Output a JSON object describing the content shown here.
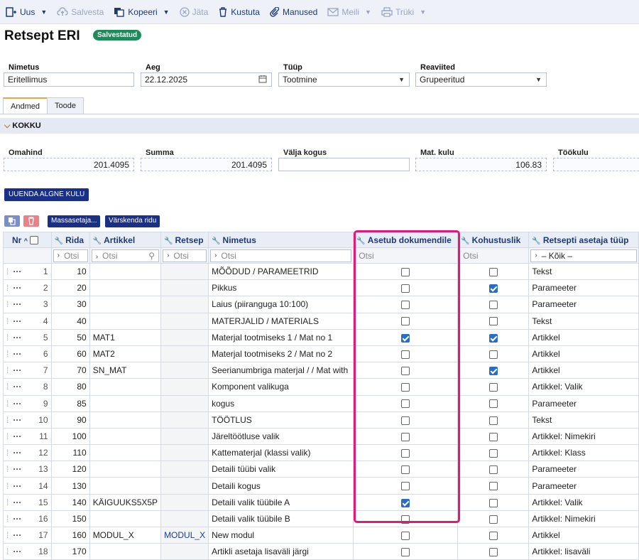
{
  "toolbar": {
    "new": "Uus",
    "save": "Salvesta",
    "copy": "Kopeeri",
    "skip": "Jäta",
    "delete": "Kustuta",
    "attachments": "Manused",
    "mail": "Meili",
    "print": "Trüki"
  },
  "header": {
    "title": "Retsept ERI",
    "status": "Salvestatud"
  },
  "form": {
    "name_label": "Nimetus",
    "name_value": "Eritellimus",
    "time_label": "Aeg",
    "time_value": "22.12.2025",
    "type_label": "Tüüp",
    "type_value": "Tootmine",
    "rows_label": "Reaviited",
    "rows_value": "Grupeeritud"
  },
  "tabs": [
    "Andmed",
    "Toode"
  ],
  "section": {
    "title": "KOKKU"
  },
  "totals": {
    "cost_label": "Omahind",
    "cost_value": "201.4095",
    "sum_label": "Summa",
    "sum_value": "201.4095",
    "output_label": "Välja kogus",
    "output_value": "",
    "mat_label": "Mat. kulu",
    "mat_value": "106.83",
    "work_label": "Töökulu"
  },
  "buttons": {
    "update": "UUENDA ALGNE KULU",
    "mass": "Massasetaja...",
    "refresh": "Värskenda ridu"
  },
  "columns": {
    "nr": "Nr",
    "rida": "Rida",
    "artikkel": "Artikkel",
    "retsep": "Retsep",
    "nimetus": "Nimetus",
    "asetub": "Asetub dokumendile",
    "kohustuslik": "Kohustuslik",
    "tyyp": "Retsepti asetaja tüüp"
  },
  "filters": {
    "search": "Otsi",
    "all": "– Kõik –"
  },
  "rows": [
    {
      "nr": "1",
      "rida": "10",
      "artikkel": "",
      "retsep": "",
      "nimetus": "MÕÕDUD / PARAMEETRID",
      "asetub": false,
      "kohustuslik": false,
      "tyyp": "Tekst"
    },
    {
      "nr": "2",
      "rida": "20",
      "artikkel": "",
      "retsep": "",
      "nimetus": "Pikkus",
      "asetub": false,
      "kohustuslik": true,
      "tyyp": "Parameeter"
    },
    {
      "nr": "3",
      "rida": "30",
      "artikkel": "",
      "retsep": "",
      "nimetus": "Laius (piiranguga 10:100)",
      "asetub": false,
      "kohustuslik": false,
      "tyyp": "Parameeter"
    },
    {
      "nr": "4",
      "rida": "40",
      "artikkel": "",
      "retsep": "",
      "nimetus": "MATERJALID / MATERIALS",
      "asetub": false,
      "kohustuslik": false,
      "tyyp": "Tekst"
    },
    {
      "nr": "5",
      "rida": "50",
      "artikkel": "MAT1",
      "retsep": "",
      "nimetus": "Materjal tootmiseks 1 / Mat no 1",
      "asetub": true,
      "kohustuslik": true,
      "tyyp": "Artikkel"
    },
    {
      "nr": "6",
      "rida": "60",
      "artikkel": "MAT2",
      "retsep": "",
      "nimetus": "Materjal tootmiseks 2 / Mat no 2",
      "asetub": false,
      "kohustuslik": false,
      "tyyp": "Artikkel"
    },
    {
      "nr": "7",
      "rida": "70",
      "artikkel": "SN_MAT",
      "retsep": "",
      "nimetus": "Seerianumbriga materjal / / Mat with",
      "asetub": false,
      "kohustuslik": true,
      "tyyp": "Artikkel"
    },
    {
      "nr": "8",
      "rida": "80",
      "artikkel": "",
      "retsep": "",
      "nimetus": "Komponent valikuga",
      "asetub": false,
      "kohustuslik": false,
      "tyyp": "Artikkel: Valik"
    },
    {
      "nr": "9",
      "rida": "85",
      "artikkel": "",
      "retsep": "",
      "nimetus": "kogus",
      "asetub": false,
      "kohustuslik": false,
      "tyyp": "Parameeter"
    },
    {
      "nr": "10",
      "rida": "90",
      "artikkel": "",
      "retsep": "",
      "nimetus": "TÖÖTLUS",
      "asetub": false,
      "kohustuslik": false,
      "tyyp": "Tekst"
    },
    {
      "nr": "11",
      "rida": "100",
      "artikkel": "",
      "retsep": "",
      "nimetus": "Järeltöötluse valik",
      "asetub": false,
      "kohustuslik": false,
      "tyyp": "Artikkel: Nimekiri"
    },
    {
      "nr": "12",
      "rida": "110",
      "artikkel": "",
      "retsep": "",
      "nimetus": "Kattematerjal (klassi valik)",
      "asetub": false,
      "kohustuslik": false,
      "tyyp": "Artikkel: Klass"
    },
    {
      "nr": "13",
      "rida": "120",
      "artikkel": "",
      "retsep": "",
      "nimetus": "Detaili tüübi valik",
      "asetub": false,
      "kohustuslik": false,
      "tyyp": "Parameeter"
    },
    {
      "nr": "14",
      "rida": "130",
      "artikkel": "",
      "retsep": "",
      "nimetus": "Detaili kogus",
      "asetub": false,
      "kohustuslik": false,
      "tyyp": "Parameeter"
    },
    {
      "nr": "15",
      "rida": "140",
      "artikkel": "KÄIGUUKS5X5P",
      "retsep": "",
      "nimetus": "Detaili valik tüübile A",
      "asetub": true,
      "kohustuslik": false,
      "tyyp": "Artikkel: Valik"
    },
    {
      "nr": "16",
      "rida": "150",
      "artikkel": "",
      "retsep": "",
      "nimetus": "Detaili valik tüübile B",
      "asetub": false,
      "kohustuslik": false,
      "tyyp": "Artikkel: Nimekiri"
    },
    {
      "nr": "17",
      "rida": "160",
      "artikkel": "MODUL_X",
      "retsep": "MODUL_X",
      "nimetus": "New modul",
      "asetub": false,
      "kohustuslik": false,
      "tyyp": "Artikkel"
    },
    {
      "nr": "18",
      "rida": "170",
      "artikkel": "",
      "retsep": "",
      "nimetus": "Artikli asetaja lisaväli järgi",
      "asetub": false,
      "kohustuslik": false,
      "tyyp": "Artikkel: lisaväli"
    }
  ]
}
